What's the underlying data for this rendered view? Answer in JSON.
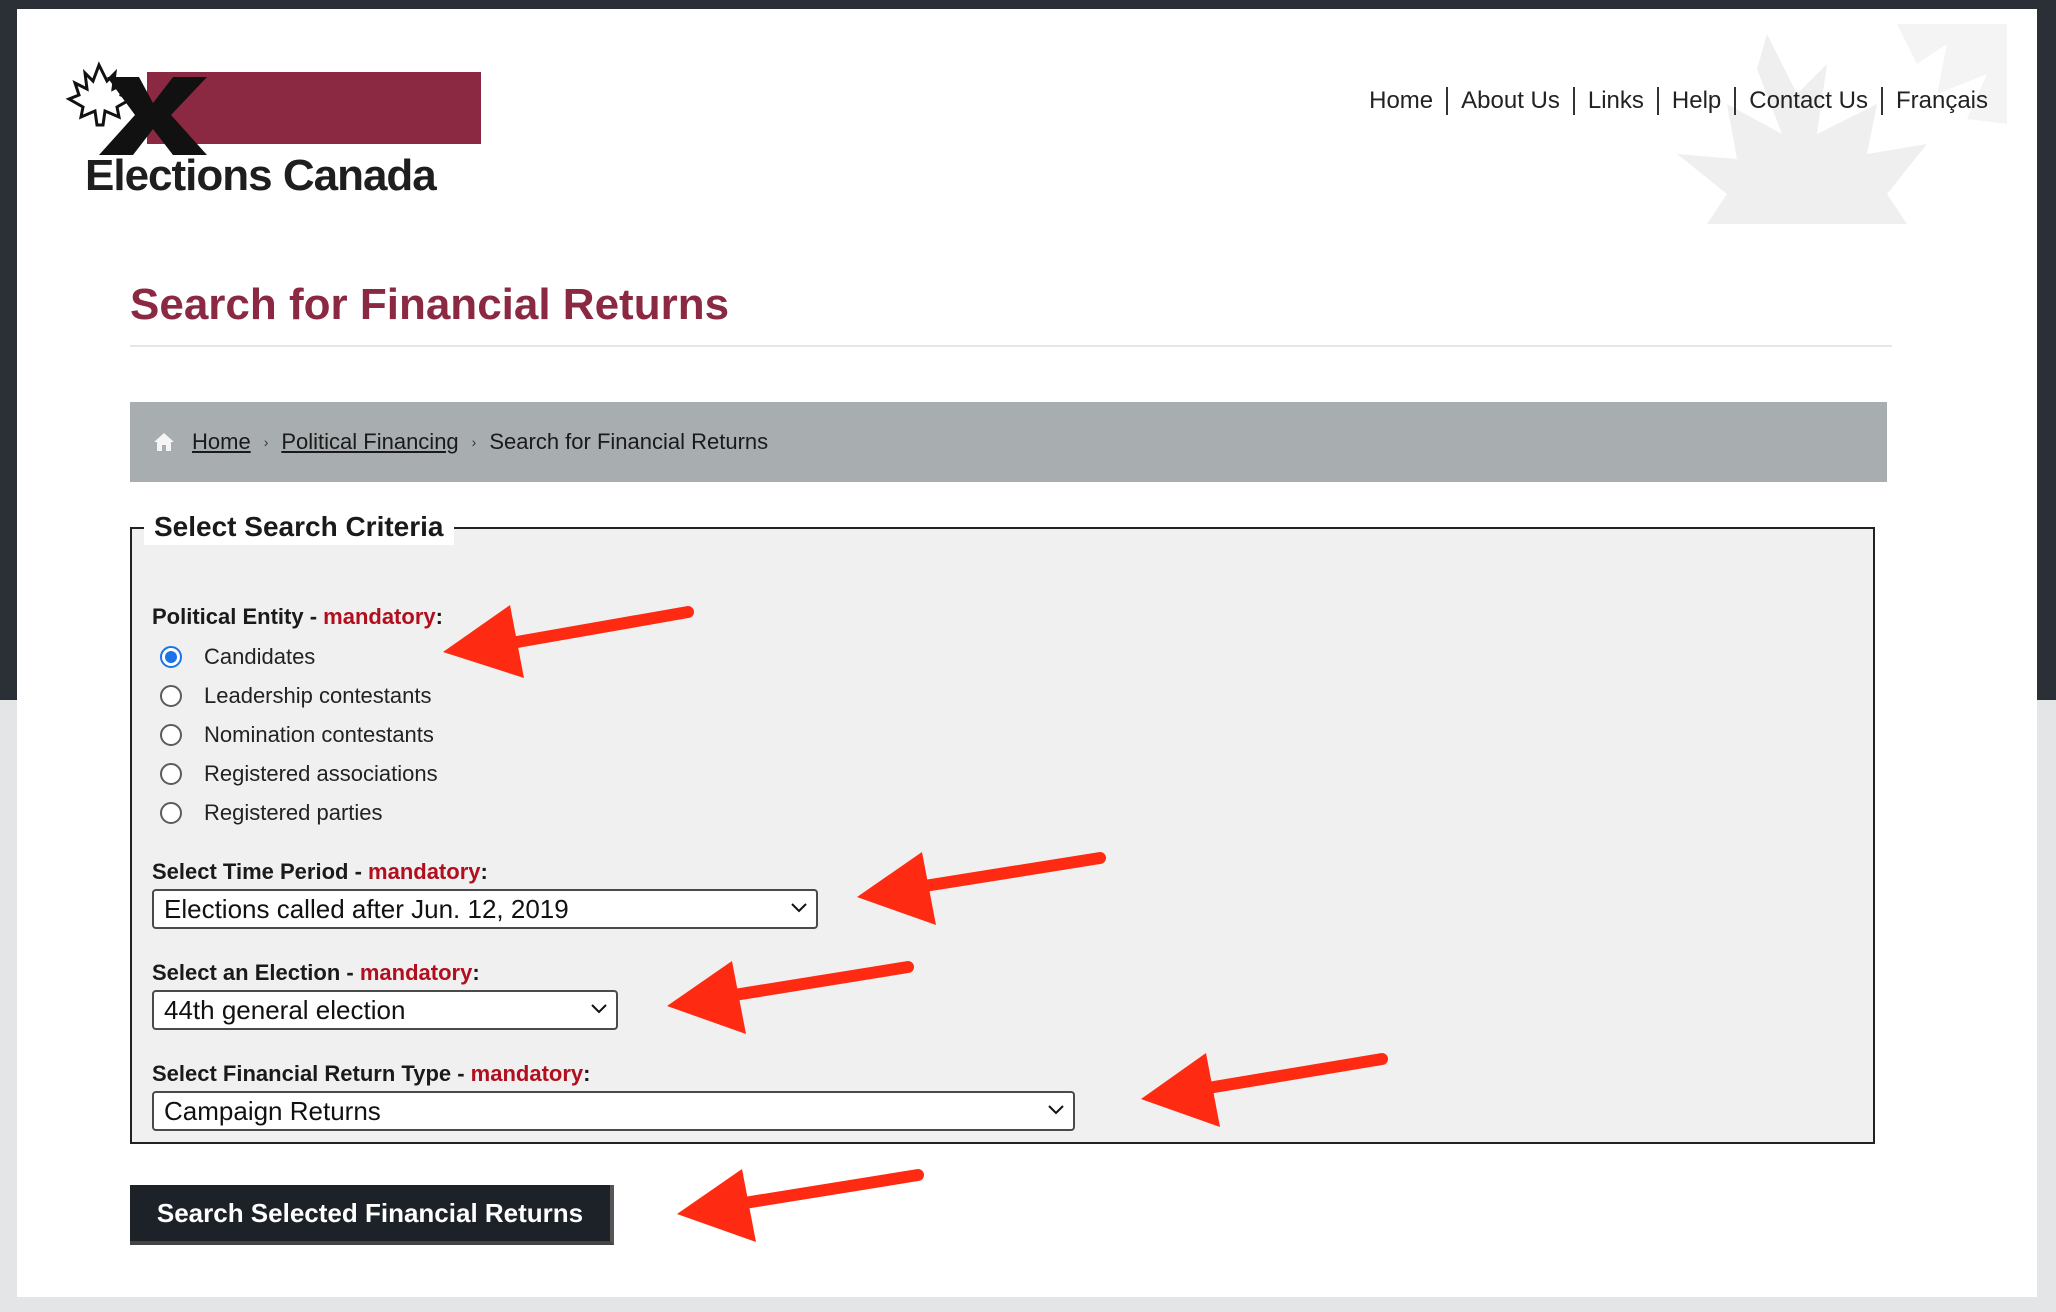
{
  "header": {
    "logo_text": "Elections Canada",
    "nav": [
      "Home",
      "About Us",
      "Links",
      "Help",
      "Contact Us",
      "Français"
    ]
  },
  "page": {
    "title": "Search for Financial Returns"
  },
  "breadcrumb": {
    "home": "Home",
    "political_financing": "Political Financing",
    "current": "Search for Financial Returns"
  },
  "criteria": {
    "legend": "Select Search Criteria",
    "entity": {
      "label": "Political Entity - ",
      "mandatory": "mandatory",
      "colon": ":",
      "options": [
        "Candidates",
        "Leadership contestants",
        "Nomination contestants",
        "Registered associations",
        "Registered parties"
      ],
      "selected": "Candidates"
    },
    "time_period": {
      "label": "Select Time Period - ",
      "mandatory": "mandatory",
      "colon": ":",
      "value": "Elections called after Jun. 12, 2019"
    },
    "election": {
      "label": "Select an Election - ",
      "mandatory": "mandatory",
      "colon": ":",
      "value": "44th general election"
    },
    "return_type": {
      "label": "Select Financial Return Type - ",
      "mandatory": "mandatory",
      "colon": ":",
      "value": "Campaign Returns"
    }
  },
  "search_button": "Search Selected Financial Returns",
  "colors": {
    "brand": "#8b2942",
    "mandatory": "#b10e1e",
    "annotation_arrow": "#ff2a12"
  }
}
